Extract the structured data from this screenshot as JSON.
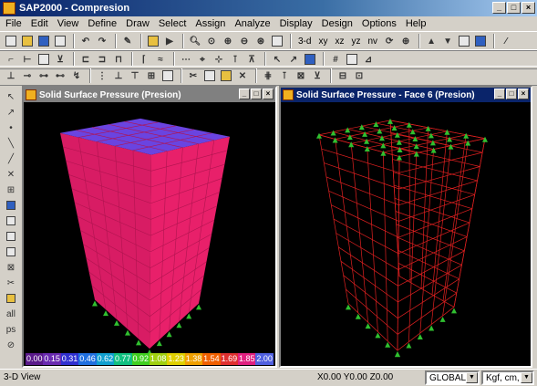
{
  "app": {
    "title": "SAP2000 - Compresion"
  },
  "menu": [
    "File",
    "Edit",
    "View",
    "Define",
    "Draw",
    "Select",
    "Assign",
    "Analyze",
    "Display",
    "Design",
    "Options",
    "Help"
  ],
  "toolbar": {
    "view_3d": "3-d",
    "view_xy": "xy",
    "view_xz": "xz",
    "view_yz": "yz",
    "view_nv": "nv"
  },
  "left_window": {
    "title": "Solid Surface Pressure (Presion)",
    "legend": [
      {
        "label": "0.00",
        "color": "#5a1a8a"
      },
      {
        "label": "0.15",
        "color": "#6a2ab0"
      },
      {
        "label": "0.31",
        "color": "#3030d0"
      },
      {
        "label": "0.46",
        "color": "#2070e0"
      },
      {
        "label": "0.62",
        "color": "#10a0d0"
      },
      {
        "label": "0.77",
        "color": "#10c080"
      },
      {
        "label": "0.92",
        "color": "#40d020"
      },
      {
        "label": "1.08",
        "color": "#a0d010"
      },
      {
        "label": "1.23",
        "color": "#e0d000"
      },
      {
        "label": "1.38",
        "color": "#f0a000"
      },
      {
        "label": "1.54",
        "color": "#f06000"
      },
      {
        "label": "1.69",
        "color": "#e03030"
      },
      {
        "label": "1.85",
        "color": "#e02080"
      },
      {
        "label": "2.00",
        "color": "#5060e0"
      }
    ]
  },
  "right_window": {
    "title": "Solid Surface Pressure - Face 6 (Presion)"
  },
  "status": {
    "view_label": "3-D View",
    "coords": "X0.00  Y0.00  Z0.00",
    "coord_system": "GLOBAL",
    "units": "Kgf, cm, C"
  },
  "colors": {
    "solid_face": "#e8206a",
    "top_face": "#7040e0",
    "wire": "#e02020",
    "support": "#30c030"
  }
}
